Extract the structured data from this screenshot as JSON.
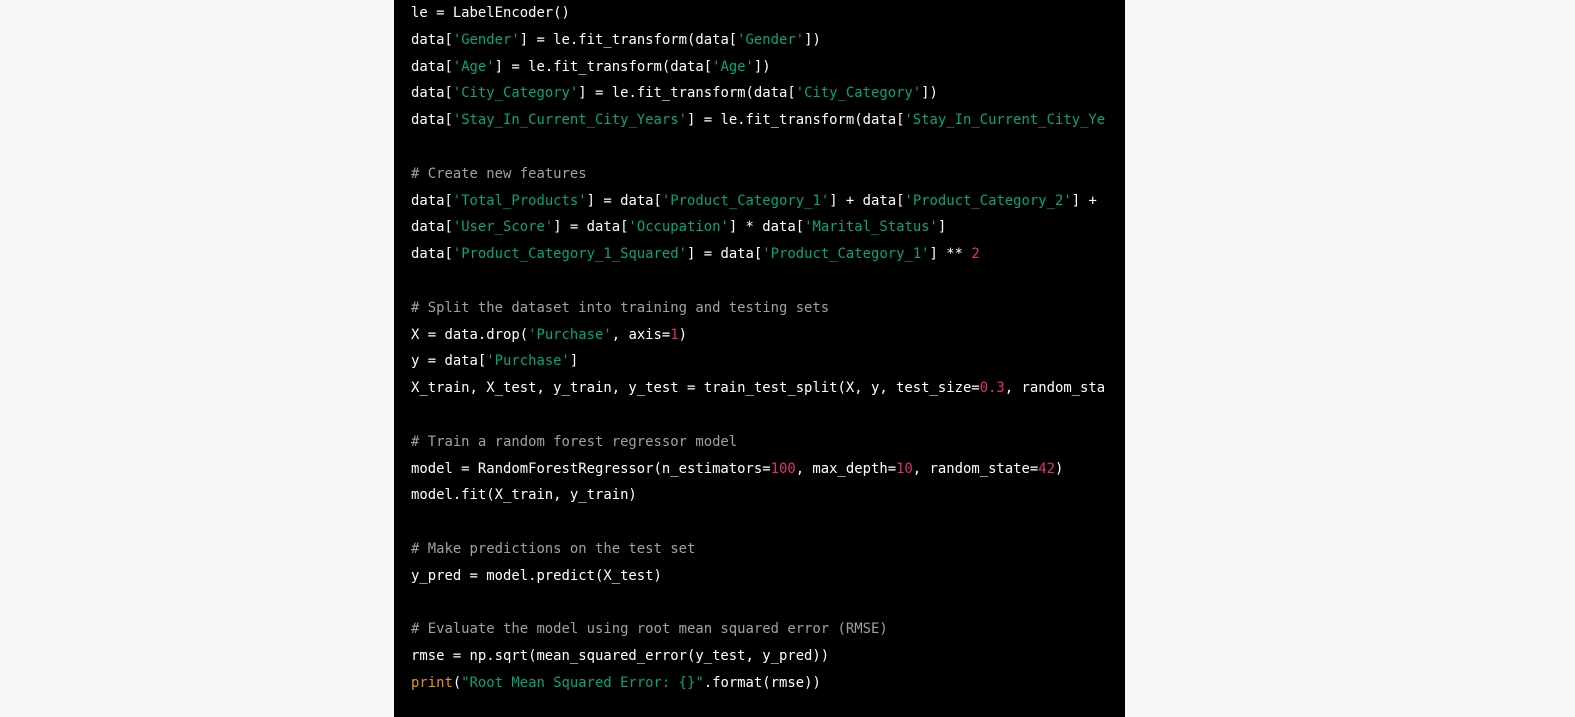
{
  "colors": {
    "background": "#f7f7f8",
    "code_bg": "#000000",
    "string": "#00a67d",
    "number": "#df3079",
    "builtin": "#e9950c",
    "comment": "#a0a0a8",
    "text": "#ffffff"
  },
  "code_lines": [
    [
      [
        "t",
        "le = LabelEncoder()"
      ]
    ],
    [
      [
        "t",
        "data["
      ],
      [
        "s",
        "'Gender'"
      ],
      [
        "t",
        "] = le.fit_transform(data["
      ],
      [
        "s",
        "'Gender'"
      ],
      [
        "t",
        "])"
      ]
    ],
    [
      [
        "t",
        "data["
      ],
      [
        "s",
        "'Age'"
      ],
      [
        "t",
        "] = le.fit_transform(data["
      ],
      [
        "s",
        "'Age'"
      ],
      [
        "t",
        "])"
      ]
    ],
    [
      [
        "t",
        "data["
      ],
      [
        "s",
        "'City_Category'"
      ],
      [
        "t",
        "] = le.fit_transform(data["
      ],
      [
        "s",
        "'City_Category'"
      ],
      [
        "t",
        "])"
      ]
    ],
    [
      [
        "t",
        "data["
      ],
      [
        "s",
        "'Stay_In_Current_City_Years'"
      ],
      [
        "t",
        "] = le.fit_transform(data["
      ],
      [
        "s",
        "'Stay_In_Current_City_Ye"
      ]
    ],
    [],
    [
      [
        "c",
        "# Create new features"
      ]
    ],
    [
      [
        "t",
        "data["
      ],
      [
        "s",
        "'Total_Products'"
      ],
      [
        "t",
        "] = data["
      ],
      [
        "s",
        "'Product_Category_1'"
      ],
      [
        "t",
        "] + data["
      ],
      [
        "s",
        "'Product_Category_2'"
      ],
      [
        "t",
        "] +"
      ]
    ],
    [
      [
        "t",
        "data["
      ],
      [
        "s",
        "'User_Score'"
      ],
      [
        "t",
        "] = data["
      ],
      [
        "s",
        "'Occupation'"
      ],
      [
        "t",
        "] * data["
      ],
      [
        "s",
        "'Marital_Status'"
      ],
      [
        "t",
        "]"
      ]
    ],
    [
      [
        "t",
        "data["
      ],
      [
        "s",
        "'Product_Category_1_Squared'"
      ],
      [
        "t",
        "] = data["
      ],
      [
        "s",
        "'Product_Category_1'"
      ],
      [
        "t",
        "] ** "
      ],
      [
        "n",
        "2"
      ]
    ],
    [],
    [
      [
        "c",
        "# Split the dataset into training and testing sets"
      ]
    ],
    [
      [
        "t",
        "X = data.drop("
      ],
      [
        "s",
        "'Purchase'"
      ],
      [
        "t",
        ", axis="
      ],
      [
        "n",
        "1"
      ],
      [
        "t",
        ")"
      ]
    ],
    [
      [
        "t",
        "y = data["
      ],
      [
        "s",
        "'Purchase'"
      ],
      [
        "t",
        "]"
      ]
    ],
    [
      [
        "t",
        "X_train, X_test, y_train, y_test = train_test_split(X, y, test_size="
      ],
      [
        "n",
        "0.3"
      ],
      [
        "t",
        ", random_sta"
      ]
    ],
    [],
    [
      [
        "c",
        "# Train a random forest regressor model"
      ]
    ],
    [
      [
        "t",
        "model = RandomForestRegressor(n_estimators="
      ],
      [
        "n",
        "100"
      ],
      [
        "t",
        ", max_depth="
      ],
      [
        "n",
        "10"
      ],
      [
        "t",
        ", random_state="
      ],
      [
        "n",
        "42"
      ],
      [
        "t",
        ")"
      ]
    ],
    [
      [
        "t",
        "model.fit(X_train, y_train)"
      ]
    ],
    [],
    [
      [
        "c",
        "# Make predictions on the test set"
      ]
    ],
    [
      [
        "t",
        "y_pred = model.predict(X_test)"
      ]
    ],
    [],
    [
      [
        "c",
        "# Evaluate the model using root mean squared error (RMSE)"
      ]
    ],
    [
      [
        "t",
        "rmse = np.sqrt(mean_squared_error(y_test, y_pred))"
      ]
    ],
    [
      [
        "k",
        "print"
      ],
      [
        "t",
        "("
      ],
      [
        "s",
        "\"Root Mean Squared Error: {}\""
      ],
      [
        "t",
        ".format(rmse))"
      ]
    ]
  ]
}
